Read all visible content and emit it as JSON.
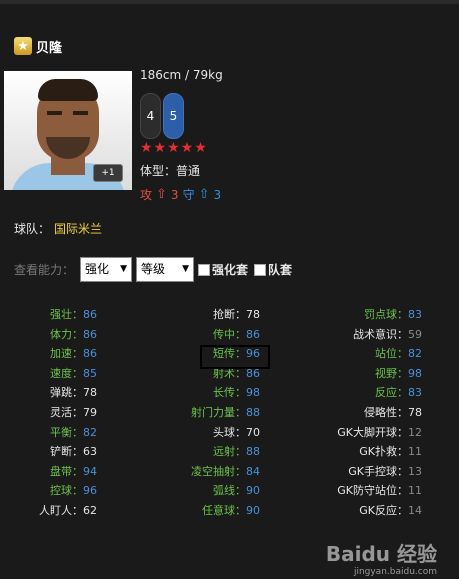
{
  "player": {
    "name": "贝隆",
    "height_weight": "186cm / 79kg",
    "left_foot": "4",
    "right_foot": "5",
    "stars": "★★★★★",
    "body_type": "体型：普通",
    "attack_label": "攻",
    "attack_value": "3",
    "defense_label": "守",
    "defense_value": "3",
    "plus_badge": "+1"
  },
  "team": {
    "label": "球队：",
    "name": "国际米兰"
  },
  "view": {
    "label": "查看能力：",
    "select1": "强化",
    "select2": "等级",
    "check1": "强化套",
    "check2": "队套"
  },
  "stats": {
    "col1": [
      {
        "label": "强壮：",
        "value": "86"
      },
      {
        "label": "体力：",
        "value": "86"
      },
      {
        "label": "加速：",
        "value": "86"
      },
      {
        "label": "速度：",
        "value": "85"
      },
      {
        "label": "弹跳：",
        "value": "78"
      },
      {
        "label": "灵活：",
        "value": "79"
      },
      {
        "label": "平衡：",
        "value": "82"
      },
      {
        "label": "铲断：",
        "value": "63"
      },
      {
        "label": "盘带：",
        "value": "94"
      },
      {
        "label": "控球：",
        "value": "96"
      },
      {
        "label": "人盯人：",
        "value": "62"
      }
    ],
    "col2": [
      {
        "label": "抢断：",
        "value": "78"
      },
      {
        "label": "传中：",
        "value": "86"
      },
      {
        "label": "短传：",
        "value": "96"
      },
      {
        "label": "射术：",
        "value": "86"
      },
      {
        "label": "长传：",
        "value": "98"
      },
      {
        "label": "射门力量：",
        "value": "88"
      },
      {
        "label": "头球：",
        "value": "70"
      },
      {
        "label": "远射：",
        "value": "88"
      },
      {
        "label": "凌空抽射：",
        "value": "84"
      },
      {
        "label": "弧线：",
        "value": "90"
      },
      {
        "label": "任意球：",
        "value": "90"
      }
    ],
    "col3": [
      {
        "label": "罚点球：",
        "value": "83"
      },
      {
        "label": "战术意识：",
        "value": "59"
      },
      {
        "label": "站位：",
        "value": "82"
      },
      {
        "label": "视野：",
        "value": "98"
      },
      {
        "label": "反应：",
        "value": "83"
      },
      {
        "label": "侵略性：",
        "value": "78"
      },
      {
        "label": "GK大脚开球：",
        "value": "12"
      },
      {
        "label": "GK扑救：",
        "value": "11"
      },
      {
        "label": "GK手控球：",
        "value": "13"
      },
      {
        "label": "GK防守站位：",
        "value": "11"
      },
      {
        "label": "GK反应：",
        "value": "14"
      }
    ]
  },
  "watermark": {
    "brand": "Baidu 经验",
    "url": "jingyan.baidu.com"
  },
  "colors": {
    "background": "#1a1a1a",
    "green_label": "#6cc24a",
    "blue_value": "#4a90d8",
    "team_yellow": "#f2d23a",
    "star_red": "#e03030"
  }
}
